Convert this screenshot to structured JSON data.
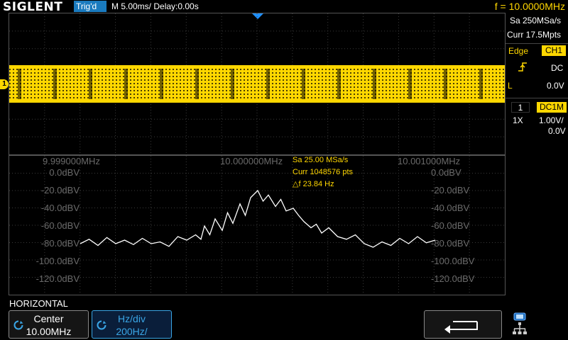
{
  "header": {
    "brand": "SIGLENT",
    "trigger_status": "Trig'd",
    "timebase": "M 5.00ms/ Delay:0.00s",
    "frequency_counter": "f = 10.0000MHz"
  },
  "acquisition": {
    "sample_rate": "Sa 250MSa/s",
    "memory_depth": "Curr 17.5Mpts"
  },
  "trigger": {
    "type": "Edge",
    "source": "CH1",
    "coupling": "DC",
    "level_label": "L",
    "level": "0.0V"
  },
  "channel": {
    "number": "1",
    "coupling": "DC1M",
    "probe": "1X",
    "scale": "1.00V/",
    "offset": "0.0V",
    "marker": "1"
  },
  "fft": {
    "x_ticks": [
      "9.999000MHz",
      "10.000000MHz",
      "10.001000MHz"
    ],
    "y_ticks_left": [
      "0.0dBV",
      "-20.0dBV",
      "-40.0dBV",
      "-60.0dBV",
      "-80.0dBV",
      "-100.0dBV",
      "-120.0dBV"
    ],
    "y_ticks_right": [
      "0.0dBV",
      "-20.0dBV",
      "-40.0dBV",
      "-60.0dBV",
      "-80.0dBV",
      "-100.0dBV",
      "-120.0dBV"
    ],
    "sample_rate": "Sa 25.00 MSa/s",
    "points": "Curr 1048576 pts",
    "resolution": "△f 23.84 Hz"
  },
  "menu": {
    "title": "HORIZONTAL",
    "center_label": "Center",
    "center_value": "10.00MHz",
    "hzdiv_label": "Hz/div",
    "hzdiv_value": "200Hz/"
  },
  "colors": {
    "ch1": "#ffd700",
    "accent": "#1e90ff",
    "fft_trace": "#ffffff",
    "grid": "#3a3a3a"
  },
  "chart_data": {
    "type": "line",
    "title": "",
    "xlabel": "",
    "ylabel": "",
    "x_unit": "MHz",
    "xlim": [
      9.999,
      10.001
    ],
    "ylim": [
      -130,
      0
    ],
    "series": [
      {
        "x": [
          9.999,
          9.99905,
          9.9991,
          9.99915,
          9.9992,
          9.99925,
          9.9993,
          9.99935,
          9.9994,
          9.99945,
          9.9995,
          9.99955,
          9.9996,
          9.99965,
          9.99968,
          9.9997,
          9.99973,
          9.99976,
          9.9998,
          9.99983,
          9.99986,
          9.9999,
          9.99993,
          9.99996,
          10.0,
          10.00003,
          10.00006,
          10.0001,
          10.00013,
          10.00016,
          10.0002,
          10.00023,
          10.00026,
          10.0003,
          10.00033,
          10.00036,
          10.0004,
          10.00045,
          10.0005,
          10.00055,
          10.0006,
          10.00065,
          10.0007,
          10.00075,
          10.0008,
          10.00085,
          10.0009,
          10.00095,
          10.001
        ],
        "y": [
          -80,
          -75,
          -82,
          -73,
          -80,
          -76,
          -81,
          -74,
          -80,
          -78,
          -83,
          -72,
          -76,
          -70,
          -75,
          -60,
          -70,
          -52,
          -65,
          -45,
          -57,
          -35,
          -48,
          -28,
          -20,
          -32,
          -25,
          -38,
          -30,
          -43,
          -40,
          -48,
          -55,
          -62,
          -58,
          -68,
          -62,
          -72,
          -75,
          -70,
          -80,
          -84,
          -78,
          -82,
          -74,
          -80,
          -72,
          -79,
          -76
        ]
      }
    ]
  }
}
